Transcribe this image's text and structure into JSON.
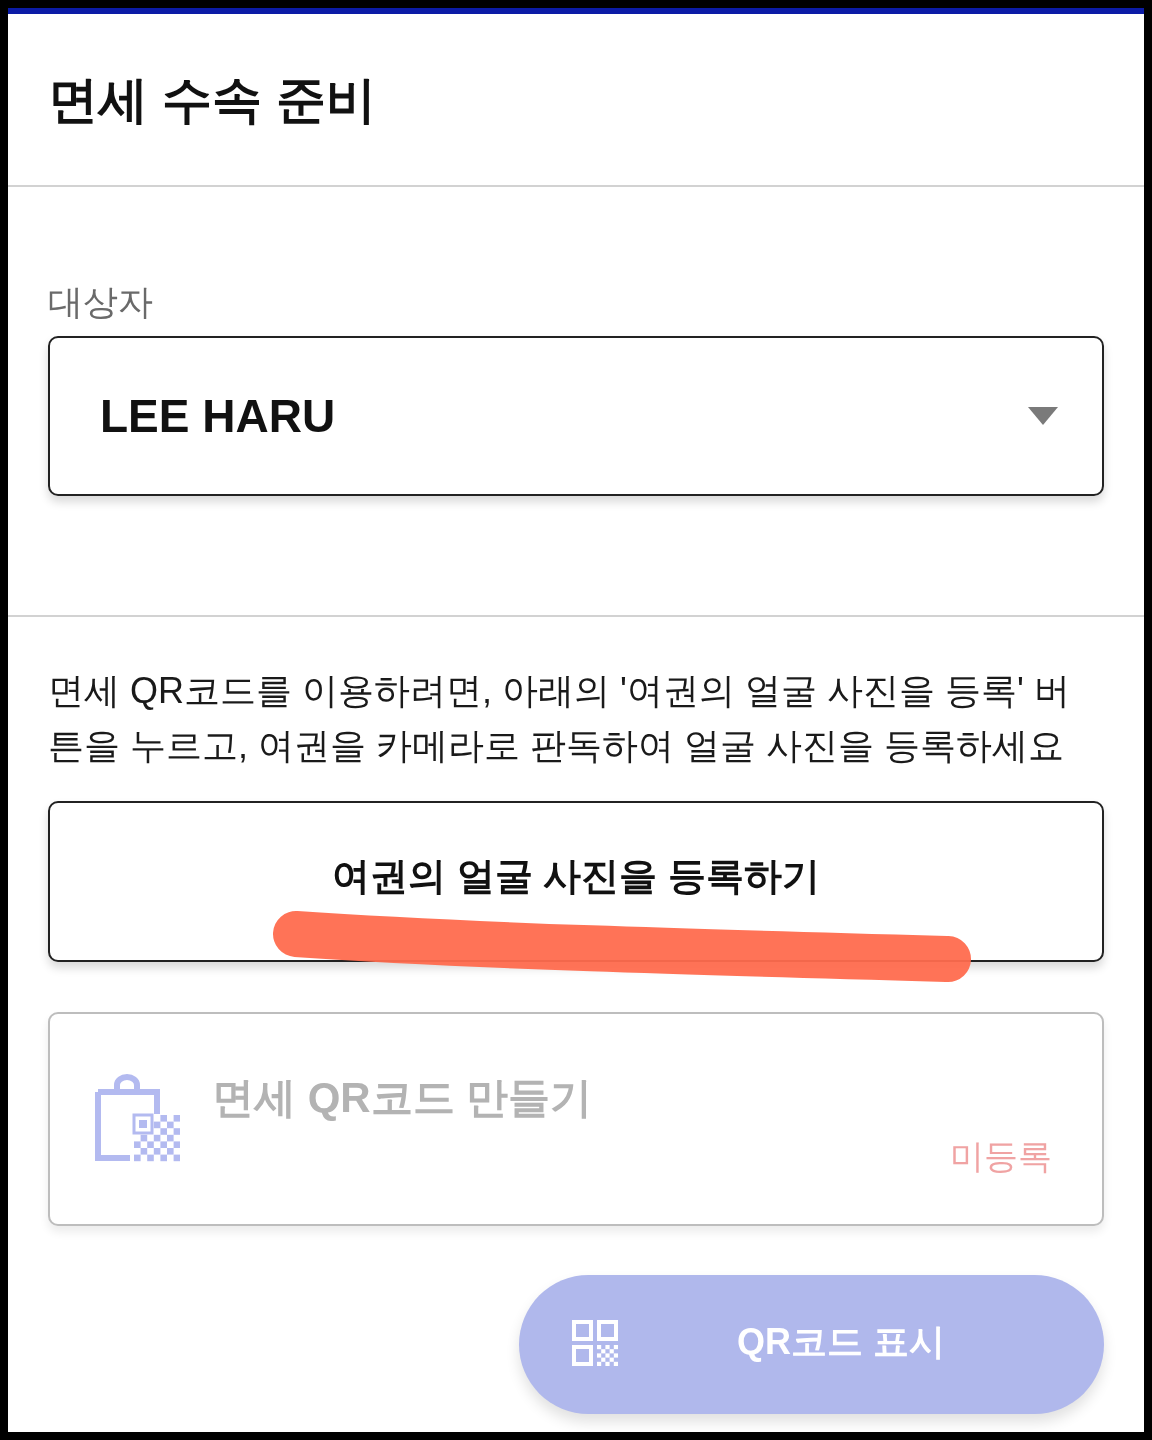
{
  "header": {
    "title": "면세 수속 준비"
  },
  "traveler_select": {
    "label": "대상자",
    "value": "LEE HARU"
  },
  "instructions": "면세 QR코드를 이용하려면, 아래의 '여권의 얼굴 사진을 등록' 버튼을 누르고, 여권을 카메라로 판독하여 얼굴 사진을 등록하세요",
  "register_button": {
    "label": "여권의 얼굴 사진을 등록하기",
    "highlighted": true
  },
  "qr_create_card": {
    "title": "면세 QR코드 만들기",
    "status": "미등록",
    "disabled": true
  },
  "show_qr_button": {
    "label": "QR코드 표시",
    "disabled": true
  }
}
